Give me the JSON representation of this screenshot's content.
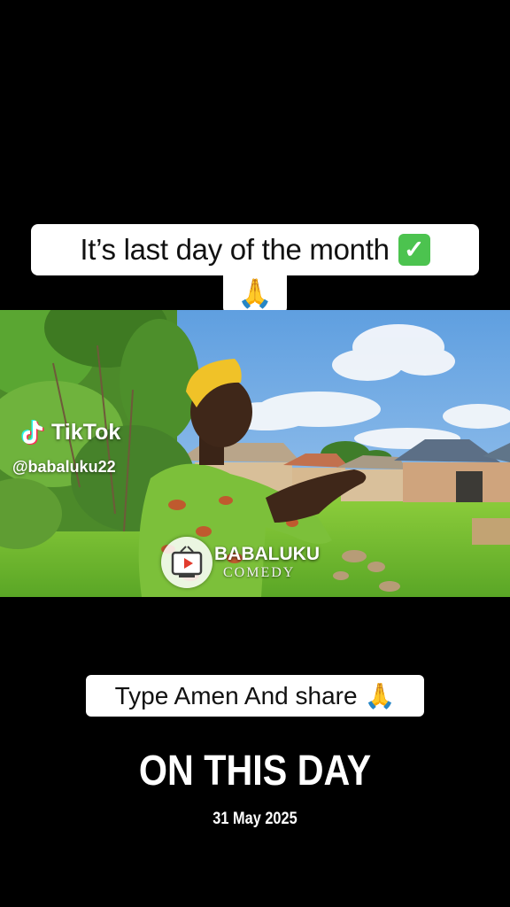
{
  "captions": {
    "top_text": "It’s last day of the month",
    "top_check_emoji": "✅",
    "top_pray_emoji": "🙏",
    "bottom_text": "Type Amen And share",
    "bottom_pray_emoji": "🙏"
  },
  "watermark": {
    "platform": "TikTok",
    "handle": "@babaluku22",
    "icon": "tiktok-logo-icon"
  },
  "brand": {
    "name": "BABALUKU",
    "subtitle": "COMEDY",
    "icon": "tv-play-icon"
  },
  "footer": {
    "title": "ON THIS DAY",
    "date": "31 May 2025"
  },
  "colors": {
    "background": "#000000",
    "caption_bg": "#ffffff",
    "check_green": "#4cc34f",
    "text_white": "#ffffff"
  }
}
